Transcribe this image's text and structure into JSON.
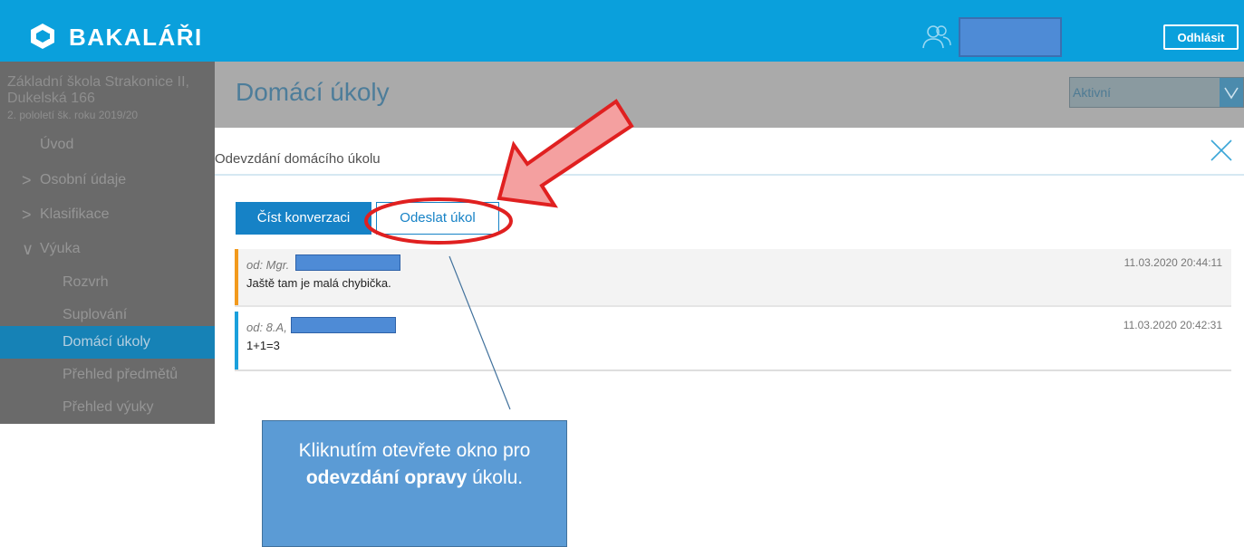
{
  "header": {
    "brand": "BAKALÁŘI",
    "logout_label": "Odhlásit"
  },
  "sidebar": {
    "school_name": "Základní škola Strakonice II, Dukelská 166",
    "school_term": "2. pololetí šk. roku 2019/20",
    "items": [
      {
        "label": "Úvod",
        "chevron": ""
      },
      {
        "label": "Osobní údaje",
        "chevron": ">"
      },
      {
        "label": "Klasifikace",
        "chevron": ">"
      },
      {
        "label": "Výuka",
        "chevron": "∨"
      },
      {
        "label": "Rozvrh"
      },
      {
        "label": "Suplování"
      },
      {
        "label": "Domácí úkoly",
        "active": true
      },
      {
        "label": "Přehled předmětů"
      },
      {
        "label": "Přehled výuky"
      }
    ]
  },
  "page": {
    "title": "Domácí úkoly",
    "status_value": "Aktivní"
  },
  "modal": {
    "title": "Odevzdání domácího úkolu",
    "tabs": [
      {
        "label": "Číst konverzaci"
      },
      {
        "label": "Odeslat úkol"
      }
    ],
    "messages": [
      {
        "from": "od: Mgr.",
        "timestamp": "11.03.2020 20:44:11",
        "text": "Jaště tam je malá chybička."
      },
      {
        "from": "od: 8.A,",
        "timestamp": "11.03.2020 20:42:31",
        "text": "1+1=3"
      }
    ]
  },
  "callout": {
    "text_before": "Kliknutím otevřete okno pro ",
    "text_bold": "odevzdání opravy",
    "text_after": " úkolu."
  },
  "colors": {
    "topbar": "#0aa0dc",
    "accent": "#1682c6",
    "highlight_red": "#e02020",
    "arrow_fill": "#f4a0a0",
    "callout_bg": "#5b9bd5"
  }
}
